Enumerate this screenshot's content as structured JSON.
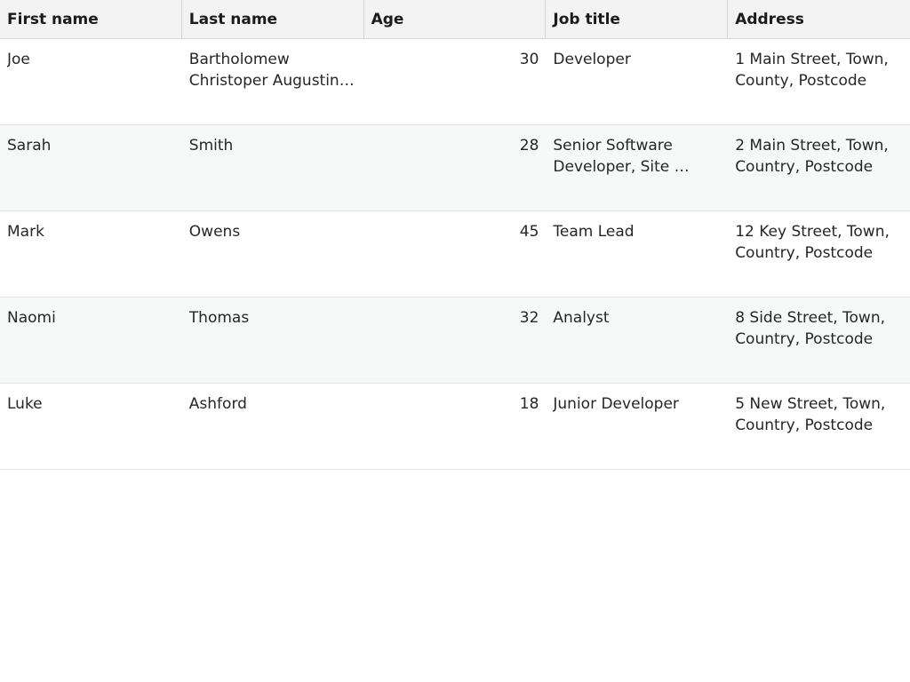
{
  "table": {
    "columns": [
      {
        "key": "first_name",
        "label": "First name"
      },
      {
        "key": "last_name",
        "label": "Last name"
      },
      {
        "key": "age",
        "label": "Age"
      },
      {
        "key": "job_title",
        "label": "Job title"
      },
      {
        "key": "address",
        "label": "Address"
      }
    ],
    "rows": [
      {
        "first_name": "Joe",
        "last_name": "Bartholomew Christoper Augustin…",
        "age": "30",
        "job_title": "Developer",
        "address": "1 Main Street, Town, County, Postcode"
      },
      {
        "first_name": "Sarah",
        "last_name": "Smith",
        "age": "28",
        "job_title": "Senior Software Developer, Site …",
        "address": "2 Main Street, Town, Country, Postcode"
      },
      {
        "first_name": "Mark",
        "last_name": "Owens",
        "age": "45",
        "job_title": "Team Lead",
        "address": "12 Key Street, Town, Country, Postcode"
      },
      {
        "first_name": "Naomi",
        "last_name": "Thomas",
        "age": "32",
        "job_title": "Analyst",
        "address": "8 Side Street, Town, Country, Postcode"
      },
      {
        "first_name": "Luke",
        "last_name": "Ashford",
        "age": "18",
        "job_title": "Junior Developer",
        "address": "5 New Street, Town, Country, Postcode"
      }
    ]
  }
}
